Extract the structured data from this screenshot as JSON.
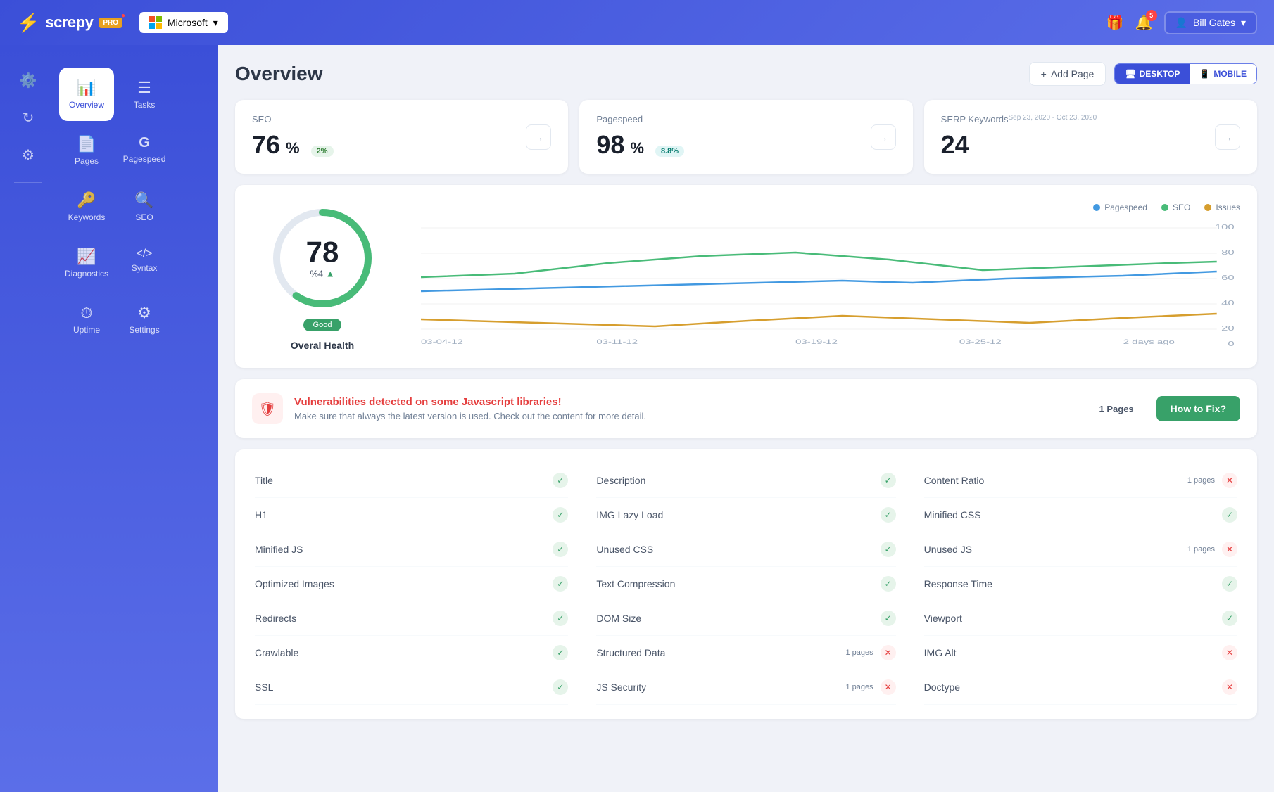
{
  "app": {
    "name": "screpy",
    "pro_badge": "PRO"
  },
  "topnav": {
    "microsoft_label": "Microsoft",
    "gift_icon": "🎁",
    "notification_count": "5",
    "user_name": "Bill Gates",
    "chevron_icon": "▾"
  },
  "sidebar": {
    "top_icons": [
      {
        "id": "tools",
        "symbol": "⚙",
        "label": ""
      },
      {
        "id": "refresh",
        "symbol": "↻",
        "label": ""
      },
      {
        "id": "settings",
        "symbol": "⚙",
        "label": ""
      }
    ],
    "nav_items": [
      {
        "id": "overview",
        "symbol": "📊",
        "label": "Overview",
        "active": true
      },
      {
        "id": "tasks",
        "symbol": "☰",
        "label": "Tasks",
        "active": false
      },
      {
        "id": "pages",
        "symbol": "📄",
        "label": "Pages",
        "active": false
      },
      {
        "id": "pagespeed",
        "symbol": "G",
        "label": "Pagespeed",
        "active": false
      },
      {
        "id": "keywords",
        "symbol": "🔑",
        "label": "Keywords",
        "active": false
      },
      {
        "id": "seo",
        "symbol": "🔍",
        "label": "SEO",
        "active": false
      },
      {
        "id": "diagnostics",
        "symbol": "📈",
        "label": "Diagnostics",
        "active": false
      },
      {
        "id": "syntax",
        "symbol": "</>",
        "label": "Syntax",
        "active": false
      },
      {
        "id": "uptime",
        "symbol": "⏱",
        "label": "Uptime",
        "active": false
      },
      {
        "id": "settings2",
        "symbol": "⚙",
        "label": "Settings",
        "active": false
      }
    ]
  },
  "page": {
    "title": "Overview",
    "add_page_label": "+ Add Page",
    "view_desktop": "DESKTOP",
    "view_mobile": "MOBILE"
  },
  "metrics": {
    "seo": {
      "label": "SEO",
      "value": "76",
      "unit": "%",
      "badge": "2%",
      "badge_type": "green"
    },
    "pagespeed": {
      "label": "Pagespeed",
      "value": "98",
      "unit": "%",
      "badge": "8.8%",
      "badge_type": "teal"
    },
    "serp": {
      "label": "SERP Keywords",
      "date_range": "Sep 23, 2020 - Oct 23, 2020",
      "value": "24"
    }
  },
  "health": {
    "score": "78",
    "percent_change": "%4",
    "trend": "▲",
    "status": "Good",
    "label": "Overal Health"
  },
  "chart": {
    "legend": [
      {
        "label": "Pagespeed",
        "color": "#4299e1"
      },
      {
        "label": "SEO",
        "color": "#48bb78"
      },
      {
        "label": "Issues",
        "color": "#d69e2e"
      }
    ],
    "x_labels": [
      "03-04-12",
      "03-11-12",
      "03-19-12",
      "03-25-12",
      "2 days ago"
    ]
  },
  "alert": {
    "title": "Vulnerabilities detected on some Javascript libraries!",
    "description": "Make sure that always the latest version is used. Check out the content for more detail.",
    "pages_count": "1 Pages",
    "fix_label": "How to Fix?"
  },
  "checks": {
    "columns": [
      [
        {
          "name": "Title",
          "status": "ok",
          "pages": null
        },
        {
          "name": "H1",
          "status": "ok",
          "pages": null
        },
        {
          "name": "Minified JS",
          "status": "ok",
          "pages": null
        },
        {
          "name": "Optimized Images",
          "status": "ok",
          "pages": null
        },
        {
          "name": "Redirects",
          "status": "ok",
          "pages": null
        },
        {
          "name": "Crawlable",
          "status": "ok",
          "pages": null
        },
        {
          "name": "SSL",
          "status": "ok",
          "pages": null
        }
      ],
      [
        {
          "name": "Description",
          "status": "ok",
          "pages": null
        },
        {
          "name": "IMG Lazy Load",
          "status": "ok",
          "pages": null
        },
        {
          "name": "Unused CSS",
          "status": "ok",
          "pages": null
        },
        {
          "name": "Text Compression",
          "status": "ok",
          "pages": null
        },
        {
          "name": "DOM Size",
          "status": "ok",
          "pages": null
        },
        {
          "name": "Structured Data",
          "status": "err",
          "pages": "1 pages"
        },
        {
          "name": "JS Security",
          "status": "err",
          "pages": "1 pages"
        }
      ],
      [
        {
          "name": "Content Ratio",
          "status": "err",
          "pages": "1 pages"
        },
        {
          "name": "Minified CSS",
          "status": "ok",
          "pages": null
        },
        {
          "name": "Unused JS",
          "status": "err",
          "pages": "1 pages"
        },
        {
          "name": "Response Time",
          "status": "ok",
          "pages": null
        },
        {
          "name": "Viewport",
          "status": "ok",
          "pages": null
        },
        {
          "name": "IMG Alt",
          "status": "err",
          "pages": null
        },
        {
          "name": "Doctype",
          "status": "err",
          "pages": null
        }
      ]
    ]
  }
}
